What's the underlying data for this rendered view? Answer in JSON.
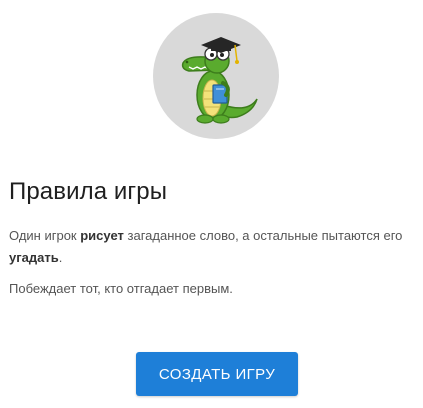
{
  "rules": {
    "title": "Правила игры",
    "p1_pre": "Один игрок ",
    "p1_bold1": "рисует",
    "p1_mid": " загаданное слово, а остальные пытаются его ",
    "p1_bold2": "угадать",
    "p1_end": ".",
    "p2": "Побеждает тот, кто отгадает первым."
  },
  "actions": {
    "create_game_label": "СОЗДАТЬ ИГРУ",
    "accent_color": "#1e7fd8"
  },
  "mascot": {
    "icon": "crocodile-graduate-icon",
    "background_color": "#d9d9d9"
  }
}
